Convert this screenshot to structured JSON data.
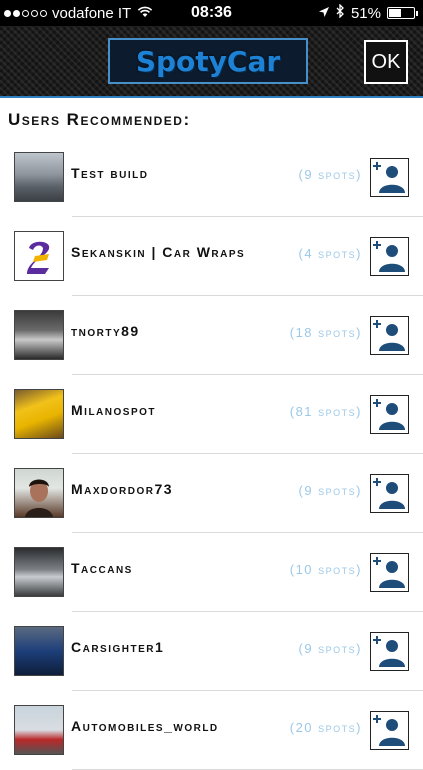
{
  "status_bar": {
    "carrier": "vodafone IT",
    "time": "08:36",
    "battery": "51%",
    "battery_level": 0.51,
    "signal_bars_filled": 2,
    "signal_bars_total": 5
  },
  "header": {
    "logo_text": "SpotyCar",
    "ok_label": "OK"
  },
  "section_title": "Users Recommended:",
  "users": [
    {
      "name": "Test build",
      "spots": "(9 spots)"
    },
    {
      "name": "Sekanskin | Car Wraps",
      "spots": "(4 spots)"
    },
    {
      "name": "tnorty89",
      "spots": "(18 spots)"
    },
    {
      "name": "Milanospot",
      "spots": "(81 spots)"
    },
    {
      "name": "Maxdordor73",
      "spots": "(9 spots)"
    },
    {
      "name": "Taccans",
      "spots": "(10 spots)"
    },
    {
      "name": "Carsighter1",
      "spots": "(9 spots)"
    },
    {
      "name": "Automobiles_world",
      "spots": "(20 spots)"
    }
  ],
  "colors": {
    "accent": "#1d82d6",
    "spots_text": "#9cc8e8",
    "follow_icon": "#1f4d7a"
  }
}
